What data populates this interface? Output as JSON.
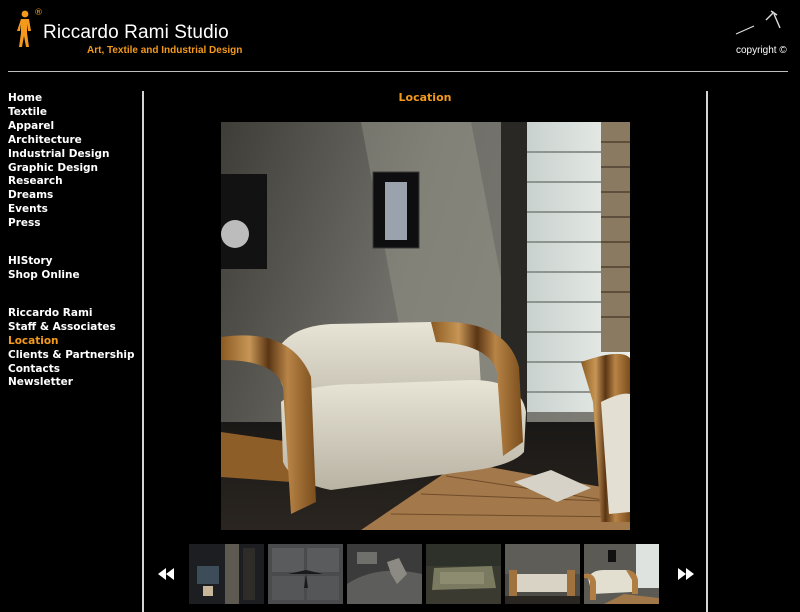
{
  "header": {
    "brand_title": "Riccardo Rami Studio",
    "brand_tagline": "Art, Textile and Industrial Design",
    "registered_mark": "®",
    "copyright": "copyright ©",
    "accent_color": "#f39a1c"
  },
  "nav": {
    "groups": [
      [
        "Home",
        "Textile",
        "Apparel",
        "Architecture",
        "Industrial Design",
        "Graphic Design",
        "Research",
        "Dreams",
        "Events",
        "Press"
      ],
      [
        "HIStory",
        "Shop Online"
      ],
      [
        "Riccardo Rami",
        "Staff & Associates",
        "Location",
        "Clients & Partnership",
        "Contacts",
        "Newsletter"
      ]
    ],
    "active": "Location"
  },
  "main": {
    "section_title": "Location"
  },
  "gallery": {
    "thumbnail_count": 6,
    "selected_index": 5,
    "prev_icon": "double-left-arrow",
    "next_icon": "double-right-arrow"
  }
}
